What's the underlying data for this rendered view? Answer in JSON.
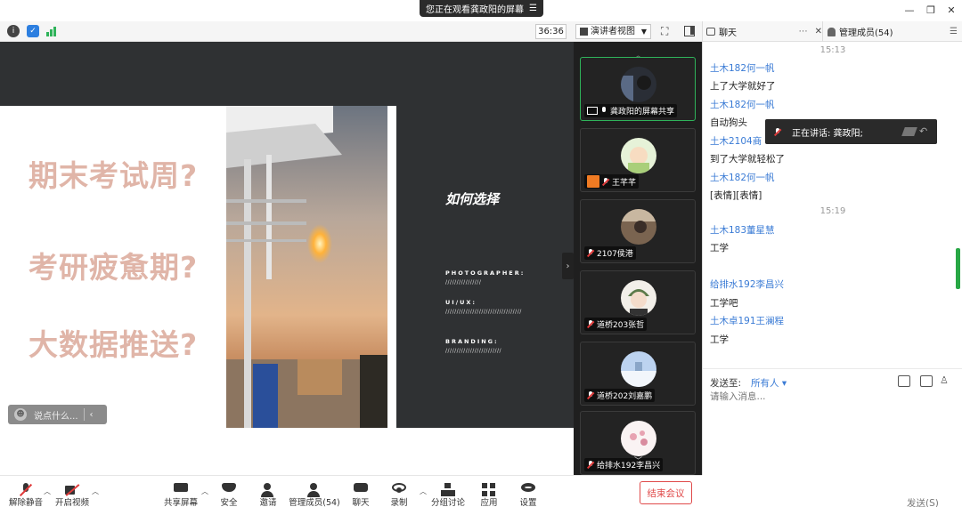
{
  "window": {
    "share_banner": "您正在观看龚政阳的屏幕",
    "share_banner_menu_icon": "menu-icon",
    "controls": [
      "minimize-icon",
      "restore-icon",
      "close-icon"
    ]
  },
  "meeting_toolbar": {
    "icons": [
      "info-icon",
      "shield-icon",
      "signal-icon"
    ],
    "timer": "36:36",
    "view_mode": "演讲者视图",
    "right_icons": [
      "fullscreen-icon",
      "sidebar-toggle-icon"
    ]
  },
  "slide": {
    "questions": [
      "期末考试周?",
      "考研疲惫期?",
      "大数据推送?"
    ],
    "heading": "如何选择",
    "meta": [
      {
        "label": "PHOTOGRAPHER:",
        "value": "////////////////"
      },
      {
        "label": "UI/UX:",
        "value": "//////////////////////////////////"
      },
      {
        "label": "BRANDING:",
        "value": "/////////////////////////"
      }
    ],
    "accent_color": "#e0b5a8"
  },
  "danmu": {
    "placeholder": "说点什么..."
  },
  "gallery": {
    "tiles": [
      {
        "name": "龚政阳的屏幕共享",
        "badge": "screen-share-icon",
        "mic": "on",
        "active": true,
        "avatar": "dark-photo-avatar"
      },
      {
        "name": "王芊芊",
        "badge": "orange-badge",
        "mic": "muted",
        "active": false,
        "avatar": "green-cartoon-avatar"
      },
      {
        "name": "2107侯港",
        "badge": "",
        "mic": "muted",
        "active": false,
        "avatar": "room-photo-avatar"
      },
      {
        "name": "道桥203张哲",
        "badge": "",
        "mic": "muted",
        "active": false,
        "avatar": "anime-avatar"
      },
      {
        "name": "道桥202刘嘉鹏",
        "badge": "",
        "mic": "muted",
        "active": false,
        "avatar": "snow-avatar"
      },
      {
        "name": "给排水192李昌兴",
        "badge": "",
        "mic": "muted",
        "active": false,
        "avatar": "flower-avatar"
      }
    ]
  },
  "panel": {
    "tab_chat": "聊天",
    "tab_members": "管理成员(54)",
    "speaking": "正在讲话: 龚政阳;",
    "messages": [
      {
        "type": "time",
        "text": "15:13"
      },
      {
        "type": "name",
        "text": "土木182何一帆"
      },
      {
        "type": "text",
        "text": "上了大学就好了"
      },
      {
        "type": "name",
        "text": "土木182何一帆"
      },
      {
        "type": "text",
        "text": "自动狗头"
      },
      {
        "type": "name",
        "text": "土木2104商"
      },
      {
        "type": "text",
        "text": "到了大学就轻松了"
      },
      {
        "type": "name",
        "text": "土木182何一帆"
      },
      {
        "type": "text",
        "text": "[表情][表情]"
      },
      {
        "type": "time",
        "text": "15:19"
      },
      {
        "type": "name",
        "text": "土木183董星慧"
      },
      {
        "type": "text",
        "text": "工学"
      },
      {
        "type": "name",
        "text": "给排水192李昌兴"
      },
      {
        "type": "text",
        "text": "工学吧"
      },
      {
        "type": "name",
        "text": "土木卓191王澜程"
      },
      {
        "type": "text",
        "text": "工学"
      }
    ],
    "send_to_label": "发送至:",
    "send_to_value": "所有人",
    "input_placeholder": "请输入消息...",
    "send_button": "发送(S)"
  },
  "bottom_toolbar": {
    "items": [
      {
        "label": "解除静音",
        "icon": "mic-muted-icon"
      },
      {
        "label": "开启视频",
        "icon": "camera-off-icon"
      },
      {
        "label": "共享屏幕",
        "icon": "share-screen-icon"
      },
      {
        "label": "安全",
        "icon": "security-shield-icon"
      },
      {
        "label": "邀请",
        "icon": "invite-icon"
      },
      {
        "label": "管理成员(54)",
        "icon": "members-icon"
      },
      {
        "label": "聊天",
        "icon": "chat-icon"
      },
      {
        "label": "录制",
        "icon": "record-icon"
      },
      {
        "label": "分组讨论",
        "icon": "breakout-icon"
      },
      {
        "label": "应用",
        "icon": "apps-icon"
      },
      {
        "label": "设置",
        "icon": "settings-gear-icon"
      }
    ],
    "end_meeting": "结束会议",
    "end_color": "#e04a4a"
  }
}
